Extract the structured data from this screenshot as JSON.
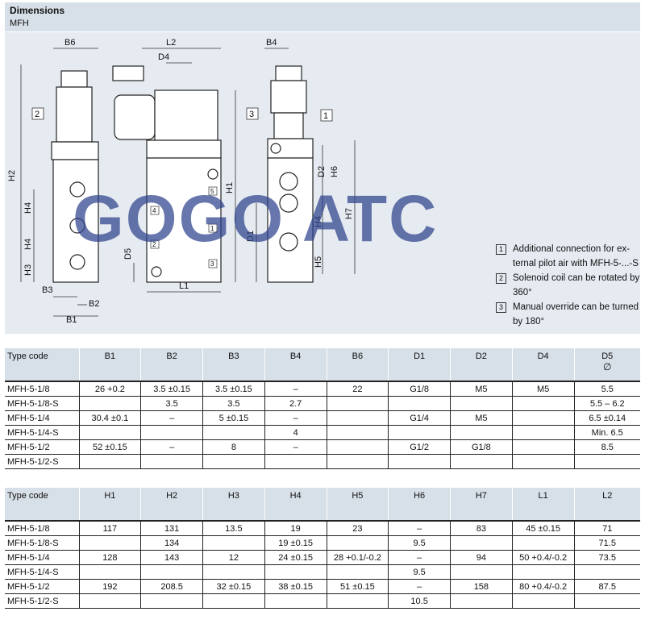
{
  "header": {
    "title": "Dimensions",
    "subtitle": "MFH"
  },
  "drawing": {
    "labels": [
      "B6",
      "L2",
      "D4",
      "B4",
      "H2",
      "H1",
      "H4",
      "H4",
      "H3",
      "D5",
      "B3",
      "B2",
      "B1",
      "L1",
      "D1",
      "D2",
      "H6",
      "H7",
      "H4",
      "H5"
    ],
    "callouts": [
      "1",
      "2",
      "3"
    ],
    "side_marks": [
      "5",
      "4",
      "1",
      "2",
      "3"
    ]
  },
  "watermark": "GOGO ATC",
  "notes": [
    {
      "num": "1",
      "text": "Additional connection for ex-ternal pilot air with MFH-5-...-S"
    },
    {
      "num": "2",
      "text": "Solenoid coil can be rotated by 360°"
    },
    {
      "num": "3",
      "text": "Manual override can be turned by 180°"
    }
  ],
  "table1": {
    "headers": [
      "Type code",
      "B1",
      "B2",
      "B3",
      "B4",
      "B6",
      "D1",
      "D2",
      "D4",
      "D5"
    ],
    "d5_symbol": "∅",
    "rows": [
      [
        "MFH-5-1/8",
        "26 +0.2",
        "3.5 ±0.15",
        "3.5 ±0.15",
        "–",
        "22",
        "G1/8",
        "M5",
        "M5",
        "5.5"
      ],
      [
        "MFH-5-1/8-S",
        "",
        "3.5",
        "3.5",
        "2.7",
        "",
        "",
        "",
        "",
        "5.5 – 6.2"
      ],
      [
        "MFH-5-1/4",
        "30.4 ±0.1",
        "–",
        "5 ±0.15",
        "–",
        "",
        "G1/4",
        "M5",
        "",
        "6.5 ±0.14"
      ],
      [
        "MFH-5-1/4-S",
        "",
        "",
        "",
        "4",
        "",
        "",
        "",
        "",
        "Min. 6.5"
      ],
      [
        "MFH-5-1/2",
        "52 ±0.15",
        "–",
        "8",
        "–",
        "",
        "G1/2",
        "G1/8",
        "",
        "8.5"
      ],
      [
        "MFH-5-1/2-S",
        "",
        "",
        "",
        "",
        "",
        "",
        "",
        "",
        ""
      ]
    ]
  },
  "table2": {
    "headers": [
      "Type code",
      "H1",
      "H2",
      "H3",
      "H4",
      "H5",
      "H6",
      "H7",
      "L1",
      "L2"
    ],
    "rows": [
      [
        "MFH-5-1/8",
        "117",
        "131",
        "13.5",
        "19",
        "23",
        "–",
        "83",
        "45 ±0.15",
        "71"
      ],
      [
        "MFH-5-1/8-S",
        "",
        "134",
        "",
        "19 ±0.15",
        "",
        "9.5",
        "",
        "",
        "71.5"
      ],
      [
        "MFH-5-1/4",
        "128",
        "143",
        "12",
        "24 ±0.15",
        "28 +0.1/-0.2",
        "–",
        "94",
        "50 +0.4/-0.2",
        "73.5"
      ],
      [
        "MFH-5-1/4-S",
        "",
        "",
        "",
        "",
        "",
        "9.5",
        "",
        "",
        ""
      ],
      [
        "MFH-5-1/2",
        "192",
        "208.5",
        "32 ±0.15",
        "38 ±0.15",
        "51 ±0.15",
        "–",
        "158",
        "80 +0.4/-0.2",
        "87.5"
      ],
      [
        "MFH-5-1/2-S",
        "",
        "",
        "",
        "",
        "",
        "10.5",
        "",
        "",
        ""
      ]
    ]
  }
}
